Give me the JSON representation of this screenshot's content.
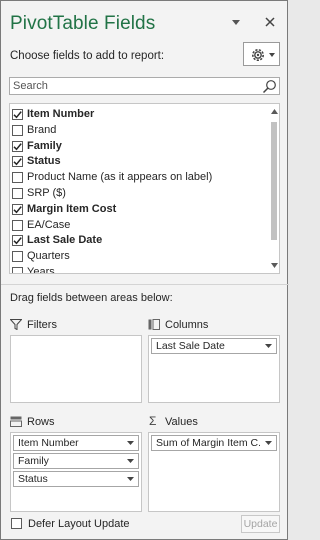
{
  "pane": {
    "title": "PivotTable Fields",
    "choose_label": "Choose fields to add to report:",
    "accent_color": "#217346"
  },
  "search": {
    "placeholder": "Search"
  },
  "fields": [
    {
      "label": "Item Number",
      "checked": true
    },
    {
      "label": "Brand",
      "checked": false
    },
    {
      "label": "Family",
      "checked": true
    },
    {
      "label": "Status",
      "checked": true
    },
    {
      "label": "Product Name (as it appears on label)",
      "checked": false
    },
    {
      "label": "SRP ($)",
      "checked": false
    },
    {
      "label": "Margin Item Cost",
      "checked": true
    },
    {
      "label": "EA/Case",
      "checked": false
    },
    {
      "label": "Last Sale Date",
      "checked": true
    },
    {
      "label": "Quarters",
      "checked": false
    },
    {
      "label": "Years",
      "checked": false
    }
  ],
  "areas": {
    "drag_label": "Drag fields between areas below:",
    "filters": {
      "title": "Filters",
      "items": []
    },
    "columns": {
      "title": "Columns",
      "items": [
        "Last Sale Date"
      ]
    },
    "rows": {
      "title": "Rows",
      "items": [
        "Item Number",
        "Family",
        "Status"
      ]
    },
    "values": {
      "title": "Values",
      "items": [
        "Sum of Margin Item C..."
      ]
    }
  },
  "footer": {
    "defer_label": "Defer Layout Update",
    "defer_checked": false,
    "update_label": "Update"
  }
}
